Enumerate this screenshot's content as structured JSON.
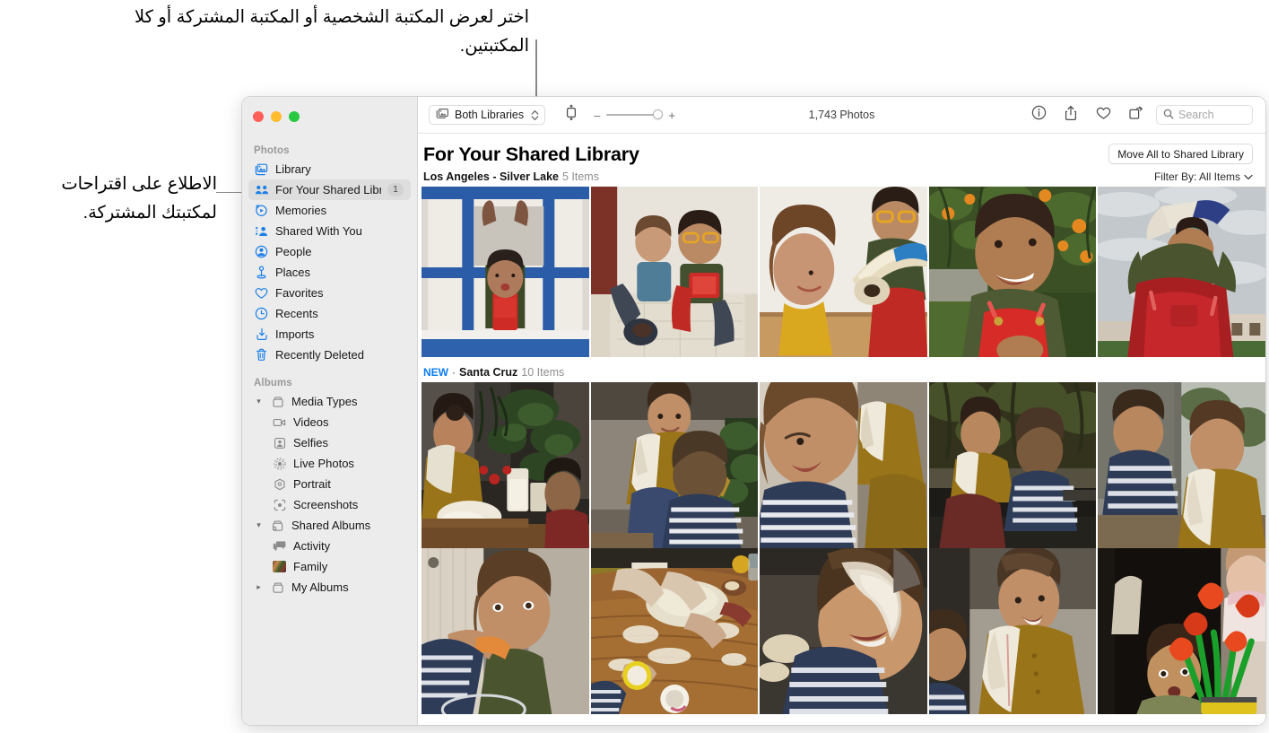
{
  "annotations": {
    "top": "اختر لعرض المكتبة الشخصية أو المكتبة المشتركة أو كلا المكتبتين.",
    "left": "الاطلاع على اقتراحات لمكتبتك المشتركة."
  },
  "window": {
    "traffic_lights": {
      "close_color": "#ff5f57",
      "minimize_color": "#febc2e",
      "zoom_color": "#28c840"
    }
  },
  "sidebar": {
    "groups": [
      {
        "title": "Photos",
        "items": [
          {
            "label": "Library",
            "icon": "library-icon",
            "selected": false,
            "badge": ""
          },
          {
            "label": "For Your Shared Library",
            "icon": "shared-library-icon",
            "selected": true,
            "badge": "1"
          },
          {
            "label": "Memories",
            "icon": "memories-icon",
            "selected": false,
            "badge": ""
          },
          {
            "label": "Shared With You",
            "icon": "shared-with-you-icon",
            "selected": false,
            "badge": ""
          },
          {
            "label": "People",
            "icon": "people-icon",
            "selected": false,
            "badge": ""
          },
          {
            "label": "Places",
            "icon": "places-icon",
            "selected": false,
            "badge": ""
          },
          {
            "label": "Favorites",
            "icon": "heart-icon",
            "selected": false,
            "badge": ""
          },
          {
            "label": "Recents",
            "icon": "clock-icon",
            "selected": false,
            "badge": ""
          },
          {
            "label": "Imports",
            "icon": "import-icon",
            "selected": false,
            "badge": ""
          },
          {
            "label": "Recently Deleted",
            "icon": "trash-icon",
            "selected": false,
            "badge": ""
          }
        ]
      },
      {
        "title": "Albums",
        "items": [
          {
            "label": "Media Types",
            "icon": "folder-icon",
            "disclosure": "expanded"
          },
          {
            "label": "Videos",
            "icon": "video-icon",
            "indent": 1
          },
          {
            "label": "Selfies",
            "icon": "selfie-icon",
            "indent": 1
          },
          {
            "label": "Live Photos",
            "icon": "live-photo-icon",
            "indent": 1
          },
          {
            "label": "Portrait",
            "icon": "portrait-icon",
            "indent": 1
          },
          {
            "label": "Screenshots",
            "icon": "screenshot-icon",
            "indent": 1
          },
          {
            "label": "Shared Albums",
            "icon": "shared-folder-icon",
            "disclosure": "expanded"
          },
          {
            "label": "Activity",
            "icon": "activity-icon",
            "indent": 1
          },
          {
            "label": "Family",
            "icon": "album-thumbnail-icon",
            "indent": 1
          },
          {
            "label": "My Albums",
            "icon": "folder-icon",
            "disclosure": "collapsed"
          }
        ]
      }
    ]
  },
  "toolbar": {
    "library_selector_label": "Both Libraries",
    "library_selector_icon": "photo-stack-icon",
    "aspect_icon": "aspect-ratio-icon",
    "zoom_out_label": "–",
    "zoom_in_label": "+",
    "photo_count": "1,743 Photos",
    "info_icon": "info-icon",
    "share_icon": "share-icon",
    "favorite_icon": "heart-icon",
    "rotate_icon": "rotate-icon",
    "search_placeholder": "Search",
    "search_value": "",
    "search_icon": "search-icon"
  },
  "main": {
    "title": "For Your Shared Library",
    "move_all_label": "Move All to Shared Library",
    "filter_label": "Filter By: All Items",
    "filter_chevron_icon": "chevron-down-icon",
    "sections": [
      {
        "new_label": "",
        "separator": "",
        "name": "Los Angeles - Silver Lake",
        "count": "5 Items"
      },
      {
        "new_label": "NEW",
        "separator": "·",
        "name": "Santa Cruz",
        "count": "10 Items"
      }
    ]
  },
  "colors": {
    "accent": "#0a7cf2",
    "sidebar_bg": "#ececec",
    "selection_bg": "#dedede"
  }
}
